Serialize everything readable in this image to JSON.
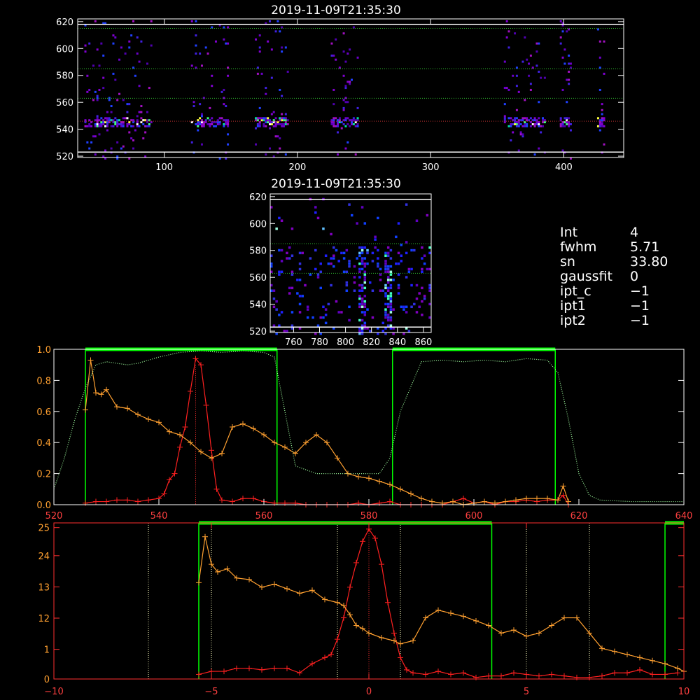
{
  "colors": {
    "background": "#000000",
    "axis": "#ffffff",
    "green": "#00ff00",
    "red": "#ff2020",
    "orange": "#ffa030",
    "light_green_dotted": "#a0ffa0",
    "pale_yellow_dotted": "#ffffc0",
    "bottom_axis": "#ff3030"
  },
  "top_panel": {
    "title": "2019-11-09T21:35:30",
    "x_ticks": [
      "100",
      "200",
      "300",
      "400"
    ],
    "y_ticks": [
      "520",
      "540",
      "560",
      "580",
      "600",
      "620"
    ]
  },
  "middle_panel": {
    "title": "2019-11-09T21:35:30",
    "x_ticks": [
      "760",
      "780",
      "800",
      "820",
      "840",
      "860"
    ],
    "y_ticks": [
      "520",
      "540",
      "560",
      "580",
      "600",
      "620"
    ]
  },
  "info": {
    "rows": [
      {
        "key": "Int",
        "value": "4"
      },
      {
        "key": "fwhm",
        "value": "5.71"
      },
      {
        "key": "sn",
        "value": "33.80"
      },
      {
        "key": "gaussfit",
        "value": "0"
      },
      {
        "key": "ipt_c",
        "value": "−1"
      },
      {
        "key": "ipt1",
        "value": "−1"
      },
      {
        "key": "ipt2",
        "value": "−1"
      }
    ]
  },
  "chart_data": [
    {
      "type": "heatmap",
      "title": "2019-11-09T21:35:30",
      "xlim": [
        35,
        445
      ],
      "ylim": [
        519,
        622
      ],
      "reference_lines_y": [
        546,
        563,
        585,
        615
      ],
      "white_lines_y": [
        523,
        618
      ],
      "bright_band_y": 546,
      "column_groups_x": [
        [
          40,
          90
        ],
        [
          120,
          148
        ],
        [
          168,
          192
        ],
        [
          225,
          245
        ],
        [
          355,
          385
        ],
        [
          397,
          405
        ],
        [
          425,
          430
        ]
      ]
    },
    {
      "type": "heatmap",
      "title": "2019-11-09T21:35:30",
      "xlim": [
        742,
        866
      ],
      "ylim": [
        519,
        622
      ],
      "reference_lines_y": [
        563,
        585
      ],
      "bright_columns_x": [
        812,
        832
      ]
    },
    {
      "type": "line",
      "xlim": [
        520,
        640
      ],
      "ylim": [
        0,
        1.0
      ],
      "x_ticks": [
        "520",
        "540",
        "560",
        "580",
        "600",
        "620",
        "640"
      ],
      "y_ticks": [
        "0.0",
        "0.2",
        "0.4",
        "0.6",
        "0.8",
        "1.0"
      ],
      "green_windows": [
        [
          526,
          562.5
        ],
        [
          584.5,
          615.5
        ]
      ],
      "series": [
        {
          "color": "red",
          "x": [
            526,
            528,
            530,
            532,
            534,
            536,
            538,
            540,
            541,
            542,
            543,
            544,
            545,
            546,
            547,
            548,
            549,
            550,
            551,
            552,
            554,
            556,
            558,
            560,
            562,
            564,
            566,
            568,
            570,
            572,
            574,
            576,
            578,
            580,
            582,
            584,
            586,
            588,
            590,
            592,
            594,
            596,
            598,
            600,
            602,
            604,
            606,
            608,
            610,
            612,
            614,
            616,
            617,
            618
          ],
          "values": [
            0.01,
            0.02,
            0.02,
            0.03,
            0.03,
            0.02,
            0.03,
            0.04,
            0.07,
            0.16,
            0.2,
            0.37,
            0.5,
            0.73,
            0.94,
            0.9,
            0.64,
            0.35,
            0.1,
            0.03,
            0.02,
            0.04,
            0.04,
            0.02,
            0.01,
            0.01,
            0.01,
            0.0,
            0.0,
            0.0,
            0.0,
            0.0,
            0.01,
            0.0,
            0.01,
            0.02,
            0.0,
            0.0,
            0.0,
            0.0,
            0.0,
            0.02,
            0.04,
            0.01,
            0.02,
            0.0,
            0.02,
            0.02,
            0.03,
            0.02,
            0.03,
            0.03,
            0.06,
            0.0
          ]
        },
        {
          "color": "orange",
          "x": [
            526,
            527,
            528,
            529,
            530,
            532,
            534,
            536,
            538,
            540,
            542,
            544,
            546,
            548,
            550,
            552,
            554,
            556,
            558,
            560,
            562,
            564,
            566,
            568,
            570,
            572,
            574,
            576,
            578,
            580,
            582,
            584,
            586,
            588,
            590,
            592,
            594,
            596,
            598,
            600,
            602,
            604,
            606,
            608,
            610,
            612,
            614,
            616,
            617,
            618
          ],
          "values": [
            0.61,
            0.93,
            0.72,
            0.71,
            0.74,
            0.63,
            0.62,
            0.58,
            0.55,
            0.53,
            0.47,
            0.45,
            0.4,
            0.34,
            0.3,
            0.33,
            0.5,
            0.52,
            0.49,
            0.45,
            0.4,
            0.37,
            0.33,
            0.4,
            0.45,
            0.4,
            0.3,
            0.2,
            0.18,
            0.17,
            0.15,
            0.13,
            0.1,
            0.07,
            0.04,
            0.02,
            0.01,
            0.02,
            0.0,
            0.01,
            0.02,
            0.01,
            0.02,
            0.03,
            0.04,
            0.04,
            0.04,
            0.03,
            0.12,
            0.02
          ]
        },
        {
          "color": "light_green_dotted",
          "x": [
            520,
            522,
            524,
            526,
            528,
            530,
            532,
            534,
            536,
            540,
            544,
            548,
            552,
            556,
            560,
            562,
            564,
            566,
            570,
            574,
            578,
            582,
            584,
            586,
            590,
            594,
            598,
            602,
            606,
            610,
            614,
            616,
            618,
            620,
            622,
            624,
            630,
            636,
            640
          ],
          "values": [
            0.1,
            0.3,
            0.55,
            0.75,
            0.9,
            0.92,
            0.91,
            0.9,
            0.91,
            0.95,
            0.98,
            0.99,
            0.98,
            0.99,
            0.98,
            0.95,
            0.6,
            0.25,
            0.2,
            0.2,
            0.2,
            0.2,
            0.3,
            0.6,
            0.92,
            0.93,
            0.92,
            0.93,
            0.92,
            0.94,
            0.93,
            0.85,
            0.55,
            0.2,
            0.06,
            0.03,
            0.02,
            0.02,
            0.02
          ]
        }
      ]
    },
    {
      "type": "line",
      "xlim": [
        -10,
        10
      ],
      "x_ticks": [
        "−10",
        "−5",
        "0",
        "5",
        "10"
      ],
      "y_ticks_left": [
        "0",
        "1",
        "12",
        "13",
        "24",
        "25"
      ],
      "green_windows": [
        [
          -5.4,
          3.9
        ],
        [
          9.4,
          10
        ]
      ],
      "dotted_lines_x": [
        -7,
        -5,
        -1,
        1,
        5,
        7
      ],
      "series": [
        {
          "color": "red",
          "x": [
            -5.4,
            -5,
            -4.6,
            -4.2,
            -3.8,
            -3.4,
            -3,
            -2.6,
            -2.2,
            -1.8,
            -1.4,
            -1.2,
            -1,
            -0.8,
            -0.6,
            -0.4,
            -0.2,
            0,
            0.2,
            0.4,
            0.6,
            0.8,
            1,
            1.2,
            1.4,
            1.8,
            2.2,
            2.6,
            3,
            3.4,
            3.8,
            4.2,
            4.6,
            5,
            5.4,
            5.8,
            6.2,
            6.6,
            7,
            7.4,
            7.8,
            8.2,
            8.6,
            9,
            9.4,
            9.8
          ],
          "values": [
            0.03,
            0.05,
            0.05,
            0.07,
            0.07,
            0.06,
            0.07,
            0.07,
            0.04,
            0.1,
            0.14,
            0.16,
            0.26,
            0.4,
            0.6,
            0.76,
            0.9,
            0.98,
            0.92,
            0.75,
            0.5,
            0.3,
            0.14,
            0.06,
            0.04,
            0.03,
            0.05,
            0.03,
            0.04,
            0.01,
            0.02,
            0.02,
            0.04,
            0.03,
            0.02,
            0.03,
            0.02,
            0.01,
            0.01,
            0.02,
            0.04,
            0.04,
            0.06,
            0.03,
            0.03,
            0.04
          ]
        },
        {
          "color": "orange",
          "x": [
            -5.4,
            -5.2,
            -5,
            -4.8,
            -4.5,
            -4.2,
            -3.8,
            -3.4,
            -3,
            -2.6,
            -2.2,
            -1.8,
            -1.4,
            -1,
            -0.8,
            -0.6,
            -0.4,
            -0.2,
            0,
            0.4,
            0.8,
            1,
            1.4,
            1.8,
            2.2,
            2.6,
            3,
            3.4,
            3.8,
            4.2,
            4.6,
            5,
            5.4,
            5.8,
            6.2,
            6.6,
            7,
            7.4,
            7.8,
            8.2,
            8.6,
            9,
            9.4,
            9.8,
            10
          ],
          "values": [
            0.63,
            0.93,
            0.75,
            0.7,
            0.72,
            0.66,
            0.65,
            0.6,
            0.62,
            0.59,
            0.56,
            0.58,
            0.52,
            0.5,
            0.48,
            0.42,
            0.35,
            0.33,
            0.3,
            0.27,
            0.25,
            0.23,
            0.25,
            0.4,
            0.45,
            0.43,
            0.41,
            0.38,
            0.35,
            0.3,
            0.32,
            0.28,
            0.3,
            0.35,
            0.4,
            0.4,
            0.3,
            0.2,
            0.18,
            0.16,
            0.14,
            0.12,
            0.1,
            0.07,
            0.05
          ]
        }
      ]
    }
  ]
}
